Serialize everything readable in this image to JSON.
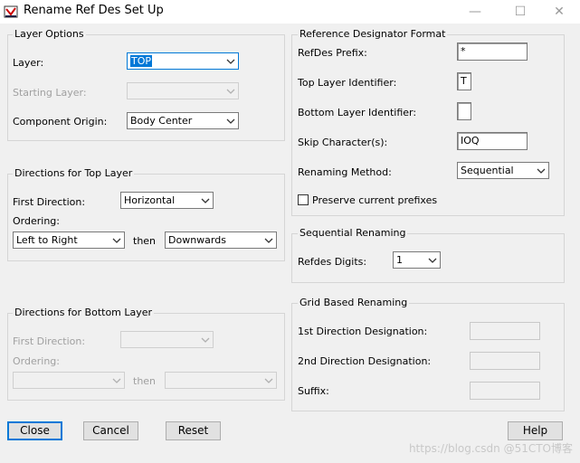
{
  "window": {
    "title": "Rename Ref Des Set Up",
    "minimize": "—",
    "maximize": "☐",
    "close": "✕"
  },
  "layer_options": {
    "title": "Layer Options",
    "layer_label": "Layer:",
    "layer_value": "TOP",
    "starting_layer_label": "Starting Layer:",
    "starting_layer_value": "",
    "origin_label": "Component Origin:",
    "origin_value": "Body Center"
  },
  "top_dirs": {
    "title": "Directions for Top Layer",
    "first_label": "First Direction:",
    "first_value": "Horizontal",
    "ordering_label": "Ordering:",
    "order1_value": "Left to Right",
    "then": "then",
    "order2_value": "Downwards"
  },
  "bottom_dirs": {
    "title": "Directions for Bottom Layer",
    "first_label": "First Direction:",
    "first_value": "",
    "ordering_label": "Ordering:",
    "order1_value": "",
    "then": "then",
    "order2_value": ""
  },
  "refdes_format": {
    "title": "Reference Designator Format",
    "prefix_label": "RefDes Prefix:",
    "prefix_value": "*",
    "top_label": "Top Layer Identifier:",
    "top_value": "T",
    "bottom_label": "Bottom Layer Identifier:",
    "bottom_value": "",
    "skip_label": "Skip Character(s):",
    "skip_value": "IOQ",
    "method_label": "Renaming Method:",
    "method_value": "Sequential",
    "preserve_label": "Preserve current prefixes",
    "preserve_checked": false
  },
  "sequential": {
    "title": "Sequential Renaming",
    "digits_label": "Refdes Digits:",
    "digits_value": "1"
  },
  "grid": {
    "title": "Grid Based Renaming",
    "first_label": "1st Direction Designation:",
    "second_label": "2nd Direction Designation:",
    "suffix_label": "Suffix:",
    "first_value": "",
    "second_value": "",
    "suffix_value": ""
  },
  "buttons": {
    "close": "Close",
    "cancel": "Cancel",
    "reset": "Reset",
    "help": "Help"
  },
  "watermark": "https://blog.csdn @51CTO博客"
}
